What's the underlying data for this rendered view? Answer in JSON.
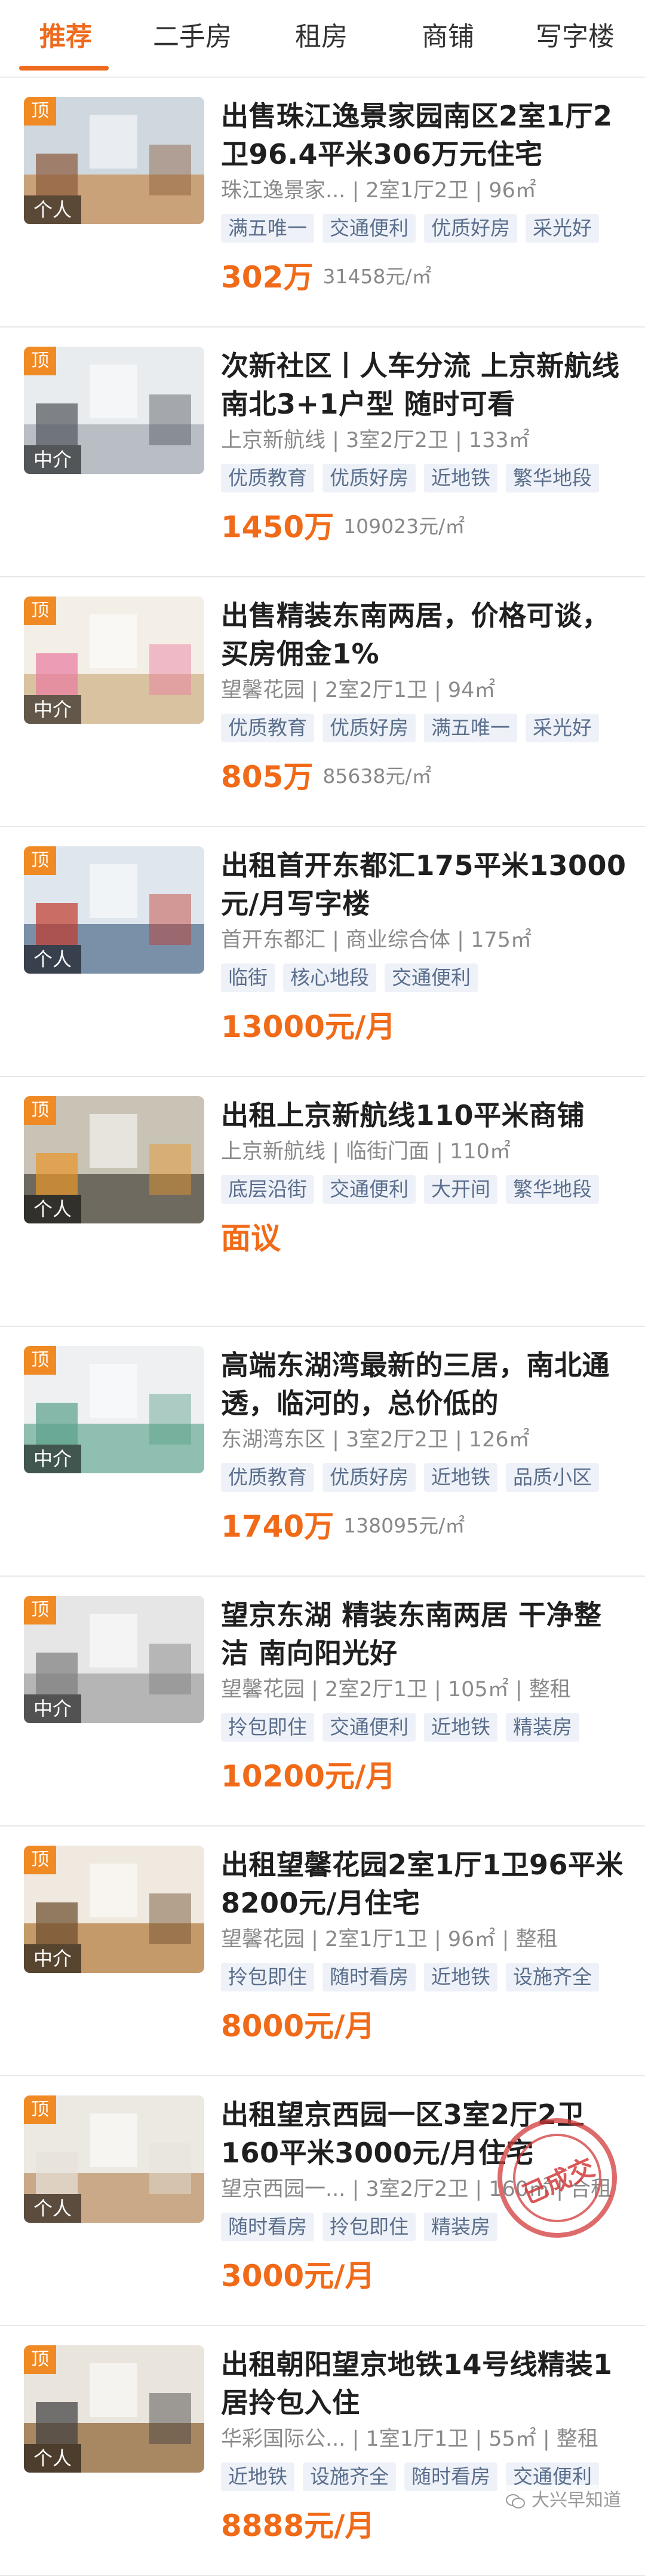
{
  "tabs": [
    {
      "label": "推荐",
      "active": true
    },
    {
      "label": "二手房",
      "active": false
    },
    {
      "label": "租房",
      "active": false
    },
    {
      "label": "商铺",
      "active": false
    },
    {
      "label": "写字楼",
      "active": false
    }
  ],
  "badge_top": "顶",
  "listings": [
    {
      "title": "出售珠江逸景家园南区2室1厅2卫96.4平米306万元住宅",
      "meta": "珠江逸景家... | 2室1厅2卫 | 96㎡",
      "tags": [
        "满五唯一",
        "交通便利",
        "优质好房",
        "采光好"
      ],
      "price": "302万",
      "unit_price": "31458元/㎡",
      "owner": "个人",
      "colors": {
        "top": "#cfd8df",
        "bottom": "#c9a27a",
        "accent": "#8a5a3a"
      }
    },
    {
      "title": "次新社区丨人车分流 上京新航线南北3+1户型 随时可看",
      "meta": "上京新航线 | 3室2厅2卫 | 133㎡",
      "tags": [
        "优质教育",
        "优质好房",
        "近地铁",
        "繁华地段"
      ],
      "price": "1450万",
      "unit_price": "109023元/㎡",
      "owner": "中介",
      "colors": {
        "top": "#e9ecef",
        "bottom": "#b9bec4",
        "accent": "#50555b"
      }
    },
    {
      "title": "出售精装东南两居，价格可谈，买房佣金1%",
      "meta": "望馨花园 | 2室2厅1卫 | 94㎡",
      "tags": [
        "优质教育",
        "优质好房",
        "满五唯一",
        "采光好"
      ],
      "price": "805万",
      "unit_price": "85638元/㎡",
      "owner": "中介",
      "colors": {
        "top": "#f4efe6",
        "bottom": "#d9c2a0",
        "accent": "#e87aa0"
      }
    },
    {
      "title": "出租首开东都汇175平米13000元/月写字楼",
      "meta": "首开东都汇 | 商业综合体 | 175㎡",
      "tags": [
        "临街",
        "核心地段",
        "交通便利"
      ],
      "price": "13000元/月",
      "unit_price": "",
      "owner": "个人",
      "colors": {
        "top": "#dfe6ee",
        "bottom": "#7a8fa8",
        "accent": "#c0392b"
      }
    },
    {
      "title": "出租上京新航线110平米商铺",
      "meta": "上京新航线 | 临街门面 | 110㎡",
      "tags": [
        "底层沿街",
        "交通便利",
        "大开间",
        "繁华地段"
      ],
      "price": "面议",
      "unit_price": "",
      "owner": "个人",
      "colors": {
        "top": "#c9c3b5",
        "bottom": "#6f6a60",
        "accent": "#e8962a"
      }
    },
    {
      "title": "高端东湖湾最新的三居，南北通透，临河的，总价低的",
      "meta": "东湖湾东区 | 3室2厅2卫 | 126㎡",
      "tags": [
        "优质教育",
        "优质好房",
        "近地铁",
        "品质小区"
      ],
      "price": "1740万",
      "unit_price": "138095元/㎡",
      "owner": "中介",
      "colors": {
        "top": "#eef0f2",
        "bottom": "#8fbfb0",
        "accent": "#5aa08a"
      }
    },
    {
      "title": "望京东湖 精装东南两居 干净整洁 南向阳光好",
      "meta": "望馨花园 | 2室2厅1卫 | 105㎡ | 整租",
      "tags": [
        "拎包即住",
        "交通便利",
        "近地铁",
        "精装房"
      ],
      "price": "10200元/月",
      "unit_price": "",
      "owner": "中介",
      "colors": {
        "top": "#e6e6e6",
        "bottom": "#b5b5b5",
        "accent": "#7c7c7c"
      }
    },
    {
      "title": "出租望馨花园2室1厅1卫96平米8200元/月住宅",
      "meta": "望馨花园 | 2室1厅1卫 | 96㎡ | 整租",
      "tags": [
        "拎包即住",
        "随时看房",
        "近地铁",
        "设施齐全"
      ],
      "price": "8000元/月",
      "unit_price": "",
      "owner": "中介",
      "colors": {
        "top": "#efe9df",
        "bottom": "#c49a6a",
        "accent": "#6b4a2b"
      }
    },
    {
      "title": "出租望京西园一区3室2厅2卫160平米3000元/月住宅",
      "meta": "望京西园一... | 3室2厅2卫 | 160㎡ | 合租",
      "tags": [
        "随时看房",
        "拎包即住",
        "精装房"
      ],
      "price": "3000元/月",
      "unit_price": "",
      "owner": "个人",
      "stamp": "已成交",
      "colors": {
        "top": "#ece8e2",
        "bottom": "#c9a987",
        "accent": "#e7e3dc"
      }
    },
    {
      "title": "出租朝阳望京地铁14号线精装1居拎包入住",
      "meta": "华彩国际公... | 1室1厅1卫 | 55㎡ | 整租",
      "tags": [
        "近地铁",
        "设施齐全",
        "随时看房",
        "交通便利"
      ],
      "price": "8888元/月",
      "unit_price": "",
      "owner": "个人",
      "colors": {
        "top": "#e9e4dc",
        "bottom": "#a88763",
        "accent": "#3d3d3d"
      }
    }
  ],
  "watermark": "大兴早知道"
}
